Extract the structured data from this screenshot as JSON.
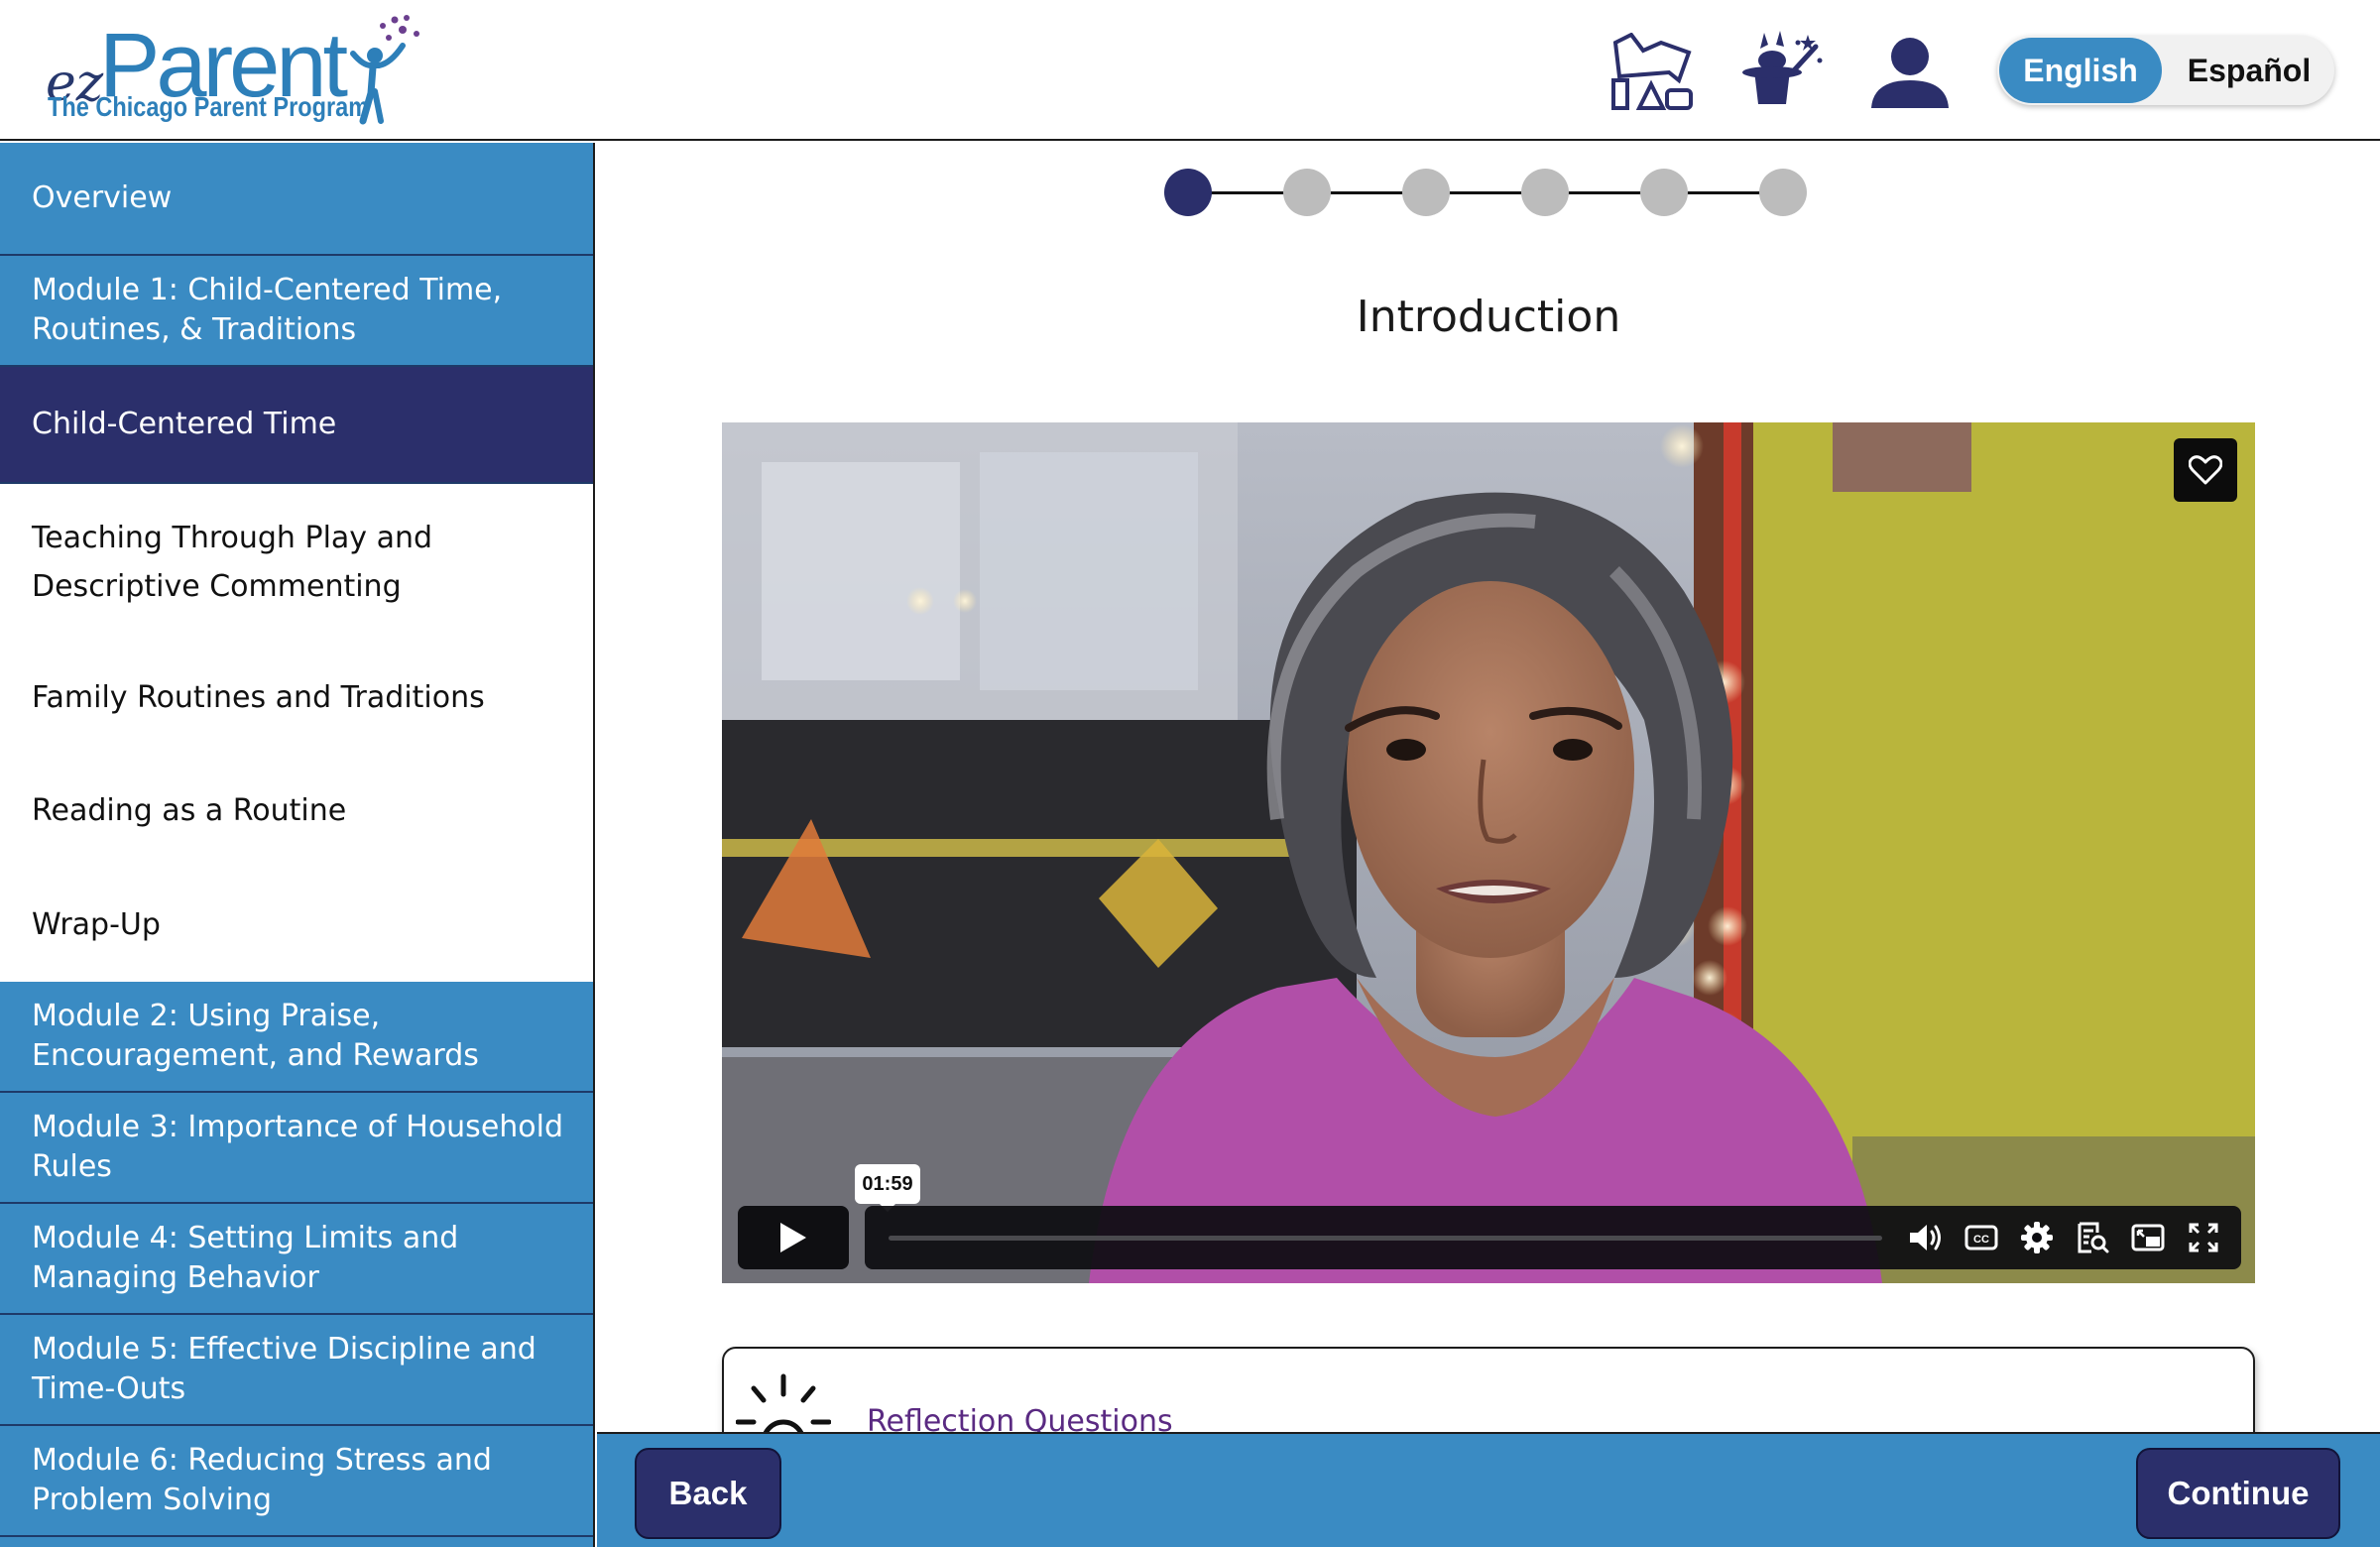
{
  "brand": {
    "logo_prefix": "ez",
    "logo_name": "Parent",
    "logo_subtitle": "The Chicago Parent Program",
    "primary_color": "#3a8bc3",
    "dark_color": "#2b2f6b",
    "accent_purple": "#5a2a82"
  },
  "header": {
    "icons": [
      "toys-icon",
      "magic-hat-icon",
      "user-profile-icon"
    ],
    "language": {
      "options": [
        "English",
        "Español"
      ],
      "selected": "English"
    }
  },
  "sidebar": {
    "overview": "Overview",
    "module1": "Module 1: Child-Centered Time, Routines, & Traditions",
    "active_lesson": "Child-Centered Time",
    "lessons": [
      "Teaching Through Play and Descriptive Commenting",
      "Family Routines and Traditions",
      "Reading as a Routine",
      "Wrap-Up"
    ],
    "modules": [
      "Module 2: Using Praise, Encouragement, and Rewards",
      "Module 3: Importance of Household Rules",
      "Module 4: Setting Limits and Managing Behavior",
      "Module 5: Effective Discipline and Time-Outs",
      "Module 6: Reducing Stress and Problem Solving"
    ]
  },
  "main": {
    "stepper": {
      "total_steps": 6,
      "current_step": 1
    },
    "title": "Introduction",
    "video": {
      "duration_label": "01:59",
      "progress": 0,
      "controls": [
        "volume-icon",
        "captions-icon",
        "settings-icon",
        "transcript-icon",
        "picture-in-picture-icon",
        "fullscreen-icon"
      ]
    },
    "reflection_label": "Reflection Questions"
  },
  "footer": {
    "back_label": "Back",
    "continue_label": "Continue"
  }
}
